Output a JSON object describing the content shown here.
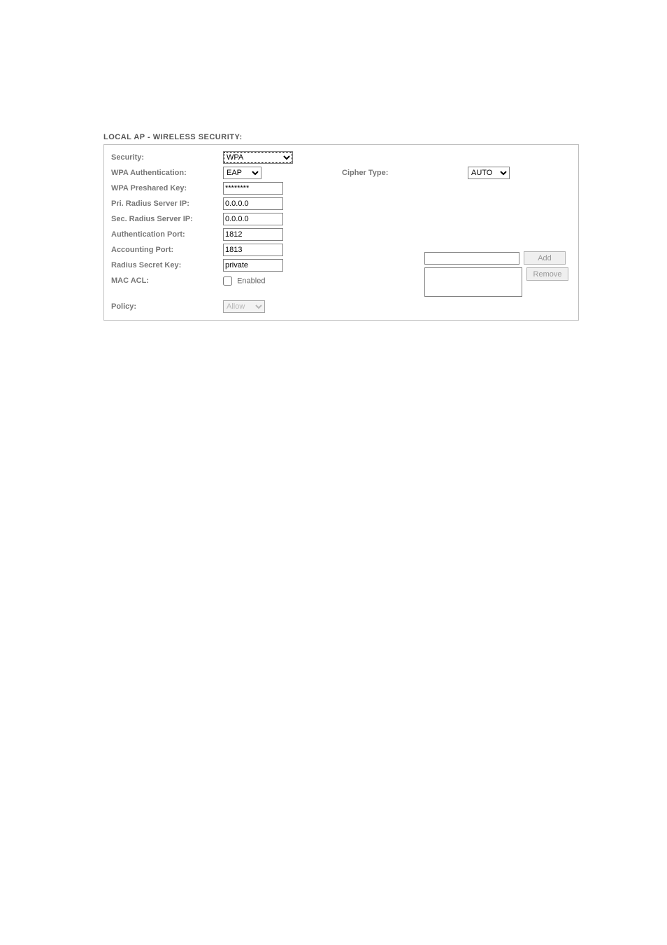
{
  "panel": {
    "title": "LOCAL AP - WIRELESS SECURITY:"
  },
  "labels": {
    "security": "Security:",
    "wpa_auth": "WPA Authentication:",
    "cipher_type": "Cipher Type:",
    "wpa_psk": "WPA Preshared Key:",
    "pri_radius": "Pri. Radius Server IP:",
    "sec_radius": "Sec. Radius Server IP:",
    "auth_port": "Authentication Port:",
    "acct_port": "Accounting Port:",
    "radius_secret": "Radius Secret Key:",
    "mac_acl": "MAC ACL:",
    "enabled": "Enabled",
    "policy": "Policy:"
  },
  "values": {
    "security": "WPA",
    "wpa_auth": "EAP",
    "cipher_type": "AUTO",
    "wpa_psk": "********",
    "pri_radius": "0.0.0.0",
    "sec_radius": "0.0.0.0",
    "auth_port": "1812",
    "acct_port": "1813",
    "radius_secret": "private",
    "mac_acl_enabled": false,
    "mac_input": "",
    "policy": "Allow"
  },
  "buttons": {
    "add": "Add",
    "remove": "Remove"
  }
}
